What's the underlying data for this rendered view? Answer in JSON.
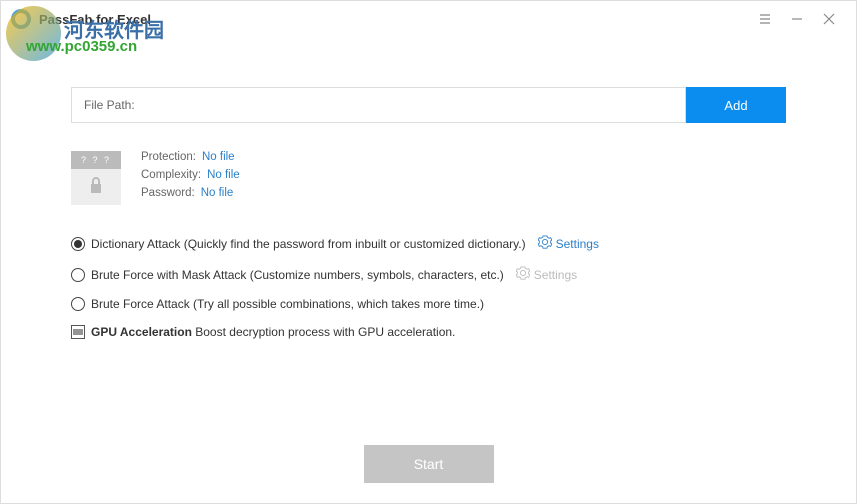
{
  "app": {
    "title": "PassFab for Excel"
  },
  "watermark": {
    "line1": "河东软件园",
    "line2": "www.pc0359.cn"
  },
  "file": {
    "label": "File Path:",
    "path": "",
    "add_btn": "Add"
  },
  "info": {
    "thumb_text": "? ? ?",
    "protection_label": "Protection:",
    "protection_val": "No file",
    "complexity_label": "Complexity:",
    "complexity_val": "No file",
    "password_label": "Password:",
    "password_val": "No file"
  },
  "options": {
    "dict": {
      "label": "Dictionary Attack (Quickly find the password from inbuilt or customized dictionary.)",
      "settings": "Settings"
    },
    "mask": {
      "label": "Brute Force with Mask Attack (Customize numbers, symbols, characters, etc.)",
      "settings": "Settings"
    },
    "brute": {
      "label": "Brute Force Attack (Try all possible combinations, which takes more time.)"
    },
    "gpu": {
      "bold": "GPU Acceleration",
      "rest": " Boost decryption process with GPU acceleration."
    }
  },
  "footer": {
    "start": "Start"
  }
}
